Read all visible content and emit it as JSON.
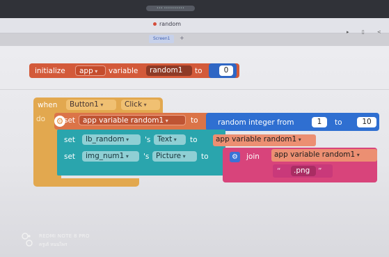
{
  "browser": {
    "url": "••• ••••••••••"
  },
  "app": {
    "title": "random",
    "screen_tab": "Screen1",
    "add_screen": "+",
    "window_controls": "▸ ▯ <"
  },
  "blocks": {
    "init": {
      "keyword": "initialize",
      "scope": "app",
      "variable_word": "variable",
      "var_name": "random1",
      "to": "to",
      "value": "0"
    },
    "event": {
      "when": "when",
      "component": "Button1",
      "event": "Click",
      "do": "do"
    },
    "set_random": {
      "set": "set",
      "target": "app variable random1",
      "to": "to",
      "random_label": "random integer from",
      "from": "1",
      "to_word": "to",
      "max": "10"
    },
    "set_text": {
      "set": "set",
      "component": "lb_random",
      "possessive": "'s",
      "property": "Text",
      "to": "to",
      "value_var": "app variable random1"
    },
    "set_picture": {
      "set": "set",
      "component": "img_num1",
      "possessive": "'s",
      "property": "Picture",
      "to": "to",
      "join": "join",
      "join_var": "app variable random1",
      "open_quote": "“",
      "text": ".png",
      "close_quote": "”"
    }
  },
  "watermark": {
    "device": "REDMI NOTE 8 PRO",
    "user": "ครูเต้ หนนไพร"
  },
  "colors": {
    "variable": "#d35a3a",
    "control": "#e2a84f",
    "math": "#2f6fd1",
    "component": "#2aa5ad",
    "text": "#d8447b"
  },
  "icons": {
    "mutator": "gear-icon",
    "join_mutator": "gear-icon",
    "camera_watermark": "dual-camera-icon"
  }
}
